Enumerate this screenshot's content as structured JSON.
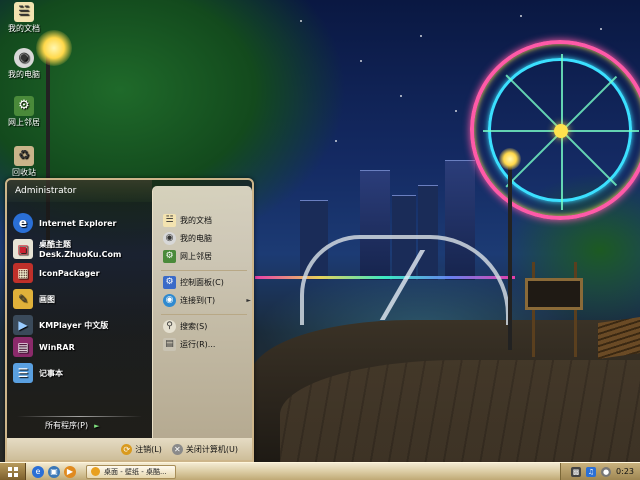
{
  "desktop": {
    "icons": [
      {
        "label": "我的文档",
        "icon": "my-documents-icon"
      },
      {
        "label": "我的电脑",
        "icon": "my-computer-icon"
      },
      {
        "label": "网上邻居",
        "icon": "network-places-icon"
      },
      {
        "label": "回收站",
        "icon": "recycle-bin-icon"
      }
    ]
  },
  "start_menu": {
    "user_name": "Administrator",
    "programs": [
      {
        "label": "Internet Explorer",
        "icon": "internet-explorer-icon"
      },
      {
        "label": "桌酷主题Desk.ZhuoKu.Com",
        "icon": "zhuoku-theme-icon"
      },
      {
        "label": "IconPackager",
        "icon": "iconpackager-icon"
      },
      {
        "label": "画图",
        "icon": "paint-icon"
      },
      {
        "label": "KMPlayer 中文版",
        "icon": "kmplayer-icon"
      },
      {
        "label": "WinRAR",
        "icon": "winrar-icon"
      },
      {
        "label": "记事本",
        "icon": "notepad-icon"
      }
    ],
    "all_programs_label": "所有程序(P)",
    "places": [
      {
        "label": "我的文档",
        "icon": "my-documents-icon"
      },
      {
        "label": "我的电脑",
        "icon": "my-computer-icon"
      },
      {
        "label": "网上邻居",
        "icon": "network-places-icon"
      }
    ],
    "system": [
      {
        "label": "控制面板(C)",
        "icon": "control-panel-icon"
      },
      {
        "label": "连接到(T)",
        "icon": "connect-to-icon"
      }
    ],
    "tools": [
      {
        "label": "搜索(S)",
        "icon": "search-icon"
      },
      {
        "label": "运行(R)...",
        "icon": "run-icon"
      }
    ],
    "logoff_label": "注销(L)",
    "shutdown_label": "关闭计算机(U)"
  },
  "taskbar": {
    "task_button_label": "桌面 - 壁纸 - 桌酷...",
    "clock": "0:23"
  },
  "colors": {
    "accent": "#cdb58a",
    "taskbar": "#d9c99f",
    "menu_right_panel": "#efe6cf"
  }
}
